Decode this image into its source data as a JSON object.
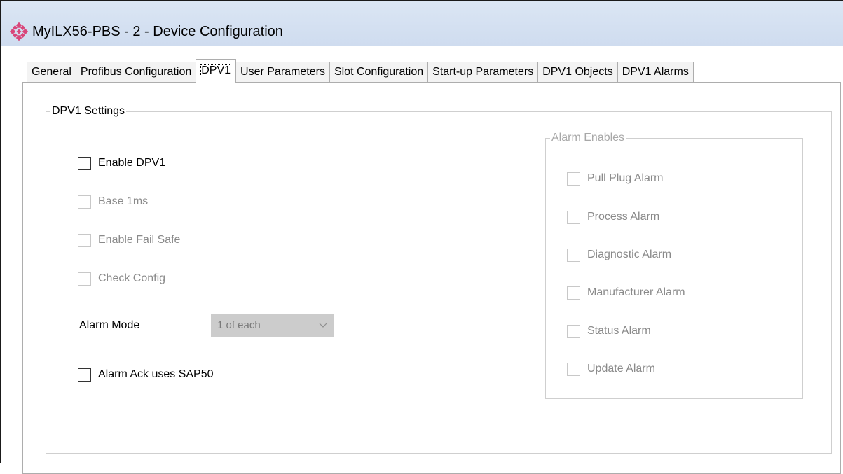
{
  "window": {
    "title": "MyILX56-PBS - 2 - Device Configuration",
    "icon": "pink-diamond-cluster-icon"
  },
  "tabs": [
    {
      "label": "General",
      "active": false
    },
    {
      "label": "Profibus Configuration",
      "active": false
    },
    {
      "label": "DPV1",
      "active": true
    },
    {
      "label": "User Parameters",
      "active": false
    },
    {
      "label": "Slot Configuration",
      "active": false
    },
    {
      "label": "Start-up Parameters",
      "active": false
    },
    {
      "label": "DPV1 Objects",
      "active": false
    },
    {
      "label": "DPV1 Alarms",
      "active": false
    }
  ],
  "dpv1_settings": {
    "legend": "DPV1 Settings",
    "enable_dpv1": {
      "label": "Enable DPV1",
      "checked": false,
      "enabled": true
    },
    "base_1ms": {
      "label": "Base 1ms",
      "checked": false,
      "enabled": false
    },
    "enable_fail_safe": {
      "label": "Enable Fail Safe",
      "checked": false,
      "enabled": false
    },
    "check_config": {
      "label": "Check Config",
      "checked": false,
      "enabled": false
    },
    "alarm_mode": {
      "label": "Alarm Mode",
      "value": "1 of each",
      "enabled": false
    },
    "alarm_ack_sap50": {
      "label": "Alarm Ack uses SAP50",
      "checked": false,
      "enabled": true
    }
  },
  "alarm_enables": {
    "legend": "Alarm Enables",
    "items": [
      {
        "label": "Pull Plug Alarm",
        "checked": false,
        "enabled": false
      },
      {
        "label": "Process Alarm",
        "checked": false,
        "enabled": false
      },
      {
        "label": "Diagnostic Alarm",
        "checked": false,
        "enabled": false
      },
      {
        "label": "Manufacturer Alarm",
        "checked": false,
        "enabled": false
      },
      {
        "label": "Status Alarm",
        "checked": false,
        "enabled": false
      },
      {
        "label": "Update Alarm",
        "checked": false,
        "enabled": false
      }
    ]
  },
  "colors": {
    "titlebar": "#dbe6f4",
    "disabled_text": "#8a8a8a",
    "icon_pink": "#d9457a"
  }
}
